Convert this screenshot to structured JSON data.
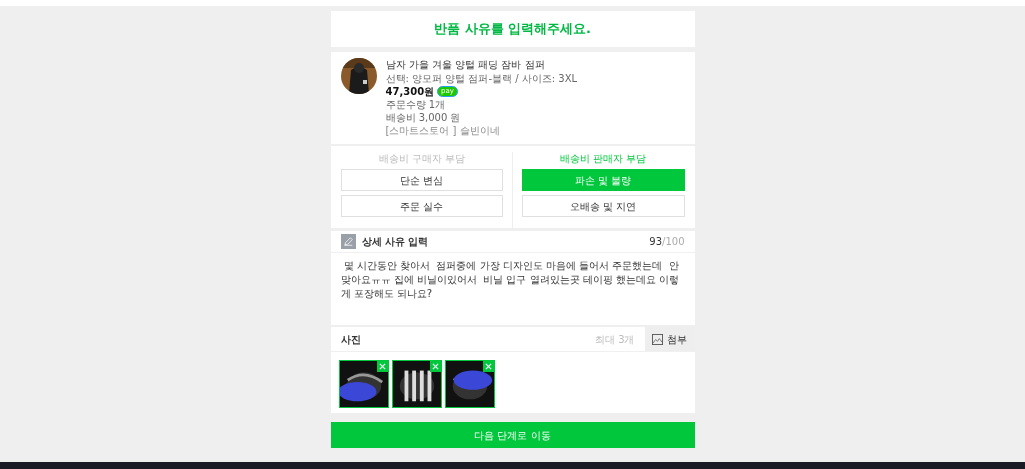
{
  "header": {
    "title": "반품 사유를 입력해주세요."
  },
  "product": {
    "name": "남자 가을 겨울 양털 패딩 잠바 점퍼",
    "option": "선택: 양모퍼 양털 점퍼-블랙 / 사이즈: 3XL",
    "price": "47,300원",
    "pay_badge": "pay",
    "quantity": "주문수량 1개",
    "shipping": "배송비 3,000 원",
    "store": "[스마트스토어 ] 슬빈이네"
  },
  "reason_groups": [
    {
      "header": "배송비 구매자 부담",
      "active": false,
      "options": [
        {
          "label": "단순 변심",
          "selected": false
        },
        {
          "label": "주문 실수",
          "selected": false
        }
      ]
    },
    {
      "header": "배송비 판매자 부담",
      "active": true,
      "options": [
        {
          "label": "파손 및 불량",
          "selected": true
        },
        {
          "label": "오배송 및 지연",
          "selected": false
        }
      ]
    }
  ],
  "detail": {
    "title": "상세 사유 입력",
    "count": "93",
    "max": "/100",
    "text": " 몇 시간동안 찾아서  점퍼중에 가장 디자인도 마음에 들어서 주문했는데  안맞아요ㅠㅠ 집에 비닐이있어서  비닐 입구 열려있는곳 테이핑 했는데요 이렇게 포장해도 되나요?"
  },
  "photos": {
    "title": "사진",
    "limit": "최대 3개",
    "attach": "첨부"
  },
  "next_button": "다음 단계로 이동"
}
